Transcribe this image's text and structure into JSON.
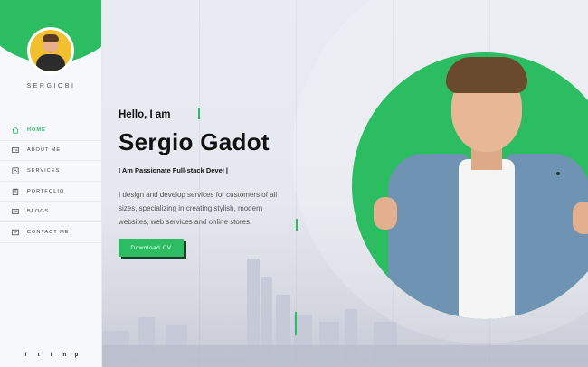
{
  "sidebar": {
    "logo": "SERGIOBI",
    "nav": [
      {
        "label": "HOME",
        "icon": "home-icon",
        "active": true
      },
      {
        "label": "ABOUT ME",
        "icon": "id-card-icon",
        "active": false
      },
      {
        "label": "SERVICES",
        "icon": "services-icon",
        "active": false
      },
      {
        "label": "PORTFOLIO",
        "icon": "portfolio-icon",
        "active": false
      },
      {
        "label": "BLOGS",
        "icon": "blog-icon",
        "active": false
      },
      {
        "label": "CONTACT ME",
        "icon": "contact-icon",
        "active": false
      }
    ],
    "social": [
      "f",
      "t",
      "i",
      "in",
      "p"
    ]
  },
  "hero": {
    "greeting": "Hello, I am",
    "name": "Sergio Gadot",
    "role": "I Am Passionate Full-stack Devel |",
    "description": "I design and develop services for customers of all sizes, specializing in creating stylish, modern websites, web services and online stores.",
    "cta": "Download CV"
  },
  "colors": {
    "accent": "#2cbd63",
    "dark": "#1e3b2a"
  }
}
